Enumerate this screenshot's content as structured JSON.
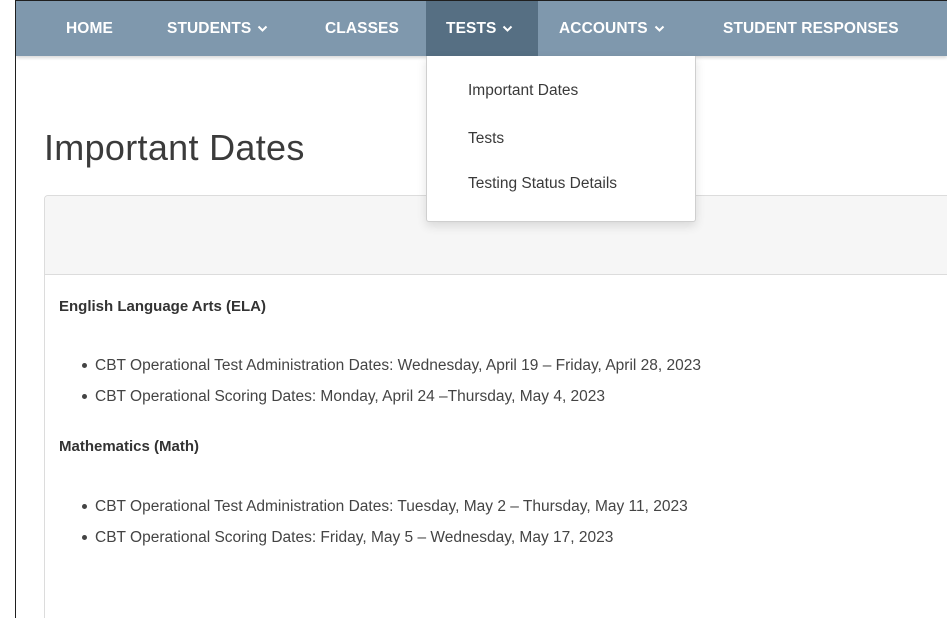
{
  "nav": {
    "items": [
      {
        "label": "HOME",
        "has_dropdown": false
      },
      {
        "label": "STUDENTS",
        "has_dropdown": true
      },
      {
        "label": "CLASSES",
        "has_dropdown": false
      },
      {
        "label": "TESTS",
        "has_dropdown": true,
        "active": true
      },
      {
        "label": "ACCOUNTS",
        "has_dropdown": true
      },
      {
        "label": "STUDENT RESPONSES",
        "has_dropdown": false
      }
    ]
  },
  "dropdown": {
    "items": [
      {
        "label": "Important Dates"
      },
      {
        "label": "Tests"
      },
      {
        "label": "Testing Status Details"
      }
    ]
  },
  "page": {
    "title": "Important Dates"
  },
  "sections": [
    {
      "title": "English Language Arts (ELA)",
      "items": [
        "CBT Operational Test Administration Dates: Wednesday, April 19 – Friday, April 28, 2023",
        "CBT Operational Scoring Dates: Monday, April 24 –Thursday, May 4, 2023"
      ]
    },
    {
      "title": "Mathematics (Math)",
      "items": [
        "CBT Operational Test Administration Dates: Tuesday, May 2 – Thursday, May 11, 2023",
        "CBT Operational Scoring Dates: Friday, May 5 – Wednesday, May 17, 2023"
      ]
    }
  ],
  "colors": {
    "navbar": "#7f98ad",
    "navbar_active": "#566f83",
    "nav_text": "#ffffff",
    "panel_header": "#f6f6f6"
  },
  "icons": {
    "dropdown_indicator": "chevron-down-icon"
  }
}
